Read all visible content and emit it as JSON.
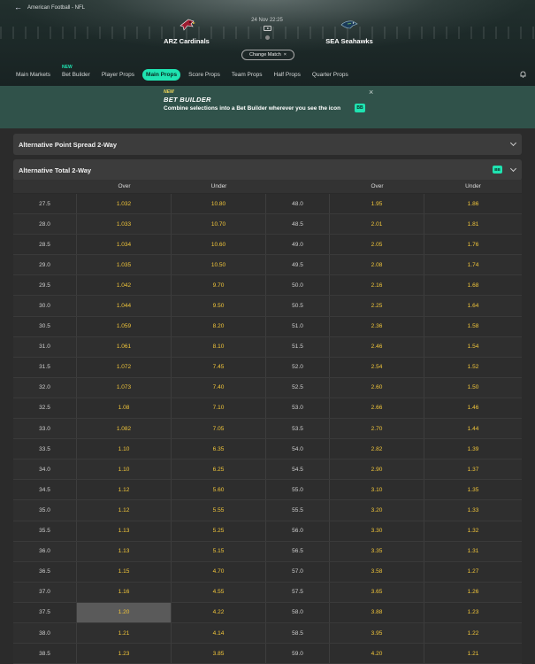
{
  "header": {
    "breadcrumb": "American Football - NFL",
    "home_team": "ARZ Cardinals",
    "away_team": "SEA Seahawks",
    "datetime": "24 Nov 22:25",
    "change_match_label": "Change Match",
    "change_match_icon": "×"
  },
  "nav": {
    "tabs": [
      {
        "label": "Main Markets",
        "new": ""
      },
      {
        "label": "Bet Builder",
        "new": "NEW"
      },
      {
        "label": "Player Props",
        "new": ""
      },
      {
        "label": "Main Props",
        "new": "",
        "active": true
      },
      {
        "label": "Score Props",
        "new": ""
      },
      {
        "label": "Team Props",
        "new": ""
      },
      {
        "label": "Half Props",
        "new": ""
      },
      {
        "label": "Quarter Props",
        "new": ""
      }
    ]
  },
  "banner": {
    "new_label": "NEW",
    "title": "BET BUILDER",
    "text": "Combine selections into a Bet Builder wherever you see the icon",
    "badge": "BB",
    "close": "×"
  },
  "sections": {
    "spread_title": "Alternative Point Spread 2-Way",
    "total_title": "Alternative Total 2-Way",
    "total_badge": "BB"
  },
  "table": {
    "headers": {
      "over": "Over",
      "under": "Under"
    },
    "rows": [
      [
        "27.5",
        "1.032",
        "10.80",
        "48.0",
        "1.95",
        "1.86"
      ],
      [
        "28.0",
        "1.033",
        "10.70",
        "48.5",
        "2.01",
        "1.81"
      ],
      [
        "28.5",
        "1.034",
        "10.60",
        "49.0",
        "2.05",
        "1.76"
      ],
      [
        "29.0",
        "1.035",
        "10.50",
        "49.5",
        "2.08",
        "1.74"
      ],
      [
        "29.5",
        "1.042",
        "9.70",
        "50.0",
        "2.16",
        "1.68"
      ],
      [
        "30.0",
        "1.044",
        "9.50",
        "50.5",
        "2.25",
        "1.64"
      ],
      [
        "30.5",
        "1.059",
        "8.20",
        "51.0",
        "2.36",
        "1.58"
      ],
      [
        "31.0",
        "1.061",
        "8.10",
        "51.5",
        "2.46",
        "1.54"
      ],
      [
        "31.5",
        "1.072",
        "7.45",
        "52.0",
        "2.54",
        "1.52"
      ],
      [
        "32.0",
        "1.073",
        "7.40",
        "52.5",
        "2.60",
        "1.50"
      ],
      [
        "32.5",
        "1.08",
        "7.10",
        "53.0",
        "2.66",
        "1.46"
      ],
      [
        "33.0",
        "1.082",
        "7.05",
        "53.5",
        "2.70",
        "1.44"
      ],
      [
        "33.5",
        "1.10",
        "6.35",
        "54.0",
        "2.82",
        "1.39"
      ],
      [
        "34.0",
        "1.10",
        "6.25",
        "54.5",
        "2.90",
        "1.37"
      ],
      [
        "34.5",
        "1.12",
        "5.60",
        "55.0",
        "3.10",
        "1.35"
      ],
      [
        "35.0",
        "1.12",
        "5.55",
        "55.5",
        "3.20",
        "1.33"
      ],
      [
        "35.5",
        "1.13",
        "5.25",
        "56.0",
        "3.30",
        "1.32"
      ],
      [
        "36.0",
        "1.13",
        "5.15",
        "56.5",
        "3.35",
        "1.31"
      ],
      [
        "36.5",
        "1.15",
        "4.70",
        "57.0",
        "3.58",
        "1.27"
      ],
      [
        "37.0",
        "1.16",
        "4.55",
        "57.5",
        "3.65",
        "1.26"
      ],
      [
        "37.5",
        "1.20",
        "4.22",
        "58.0",
        "3.88",
        "1.23"
      ],
      [
        "38.0",
        "1.21",
        "4.14",
        "58.5",
        "3.95",
        "1.22"
      ],
      [
        "38.5",
        "1.23",
        "3.85",
        "59.0",
        "4.20",
        "1.21"
      ]
    ],
    "highlight_row": 20
  },
  "colors": {
    "accent": "#1fe3b1",
    "odds": "#f2c63a",
    "banner_bg": "#30524a"
  }
}
